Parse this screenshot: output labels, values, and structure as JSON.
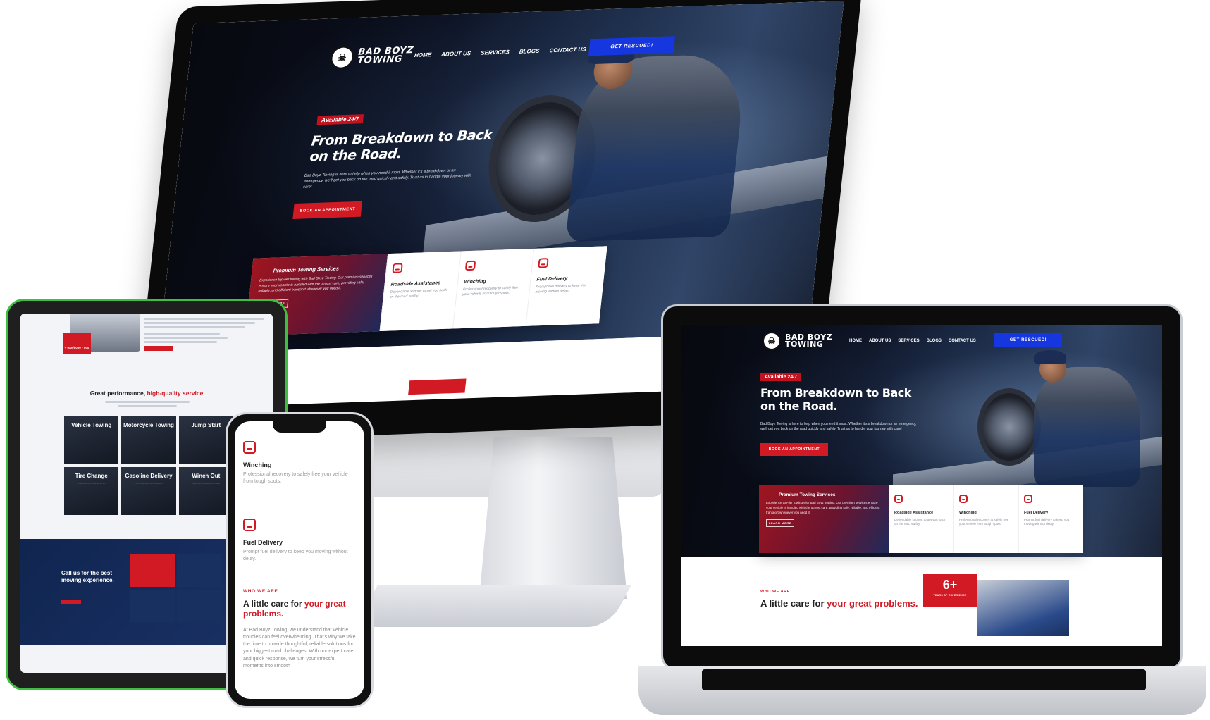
{
  "brand": {
    "name_line1": "BAD BOYZ",
    "name_line2": "TOWING"
  },
  "nav": [
    "HOME",
    "ABOUT US",
    "SERVICES",
    "BLOGS",
    "CONTACT US"
  ],
  "cta": "GET RESCUED!",
  "hero": {
    "badge": "Available 24/7",
    "title_line1": "From Breakdown to Back",
    "title_line2": "on the Road.",
    "subtitle": "Bad Boyz Towing is here to help when you need it most. Whether it's a breakdown or an emergency, we'll get you back on the road quickly and safely. Trust us to handle your journey with care!",
    "button": "BOOK AN APPOINTMENT"
  },
  "services": {
    "premium_title": "Premium Towing Services",
    "premium_text": "Experience top-tier towing with Bad Boyz Towing. Our premium services ensure your vehicle is handled with the utmost care, providing safe, reliable, and efficient transport whenever you need it.",
    "learn_more": "LEARN MORE",
    "cards": [
      {
        "title": "Roadside Assistance",
        "text": "Dependable support to get you back on the road swiftly."
      },
      {
        "title": "Winching",
        "text": "Professional recovery to safely free your vehicle from tough spots."
      },
      {
        "title": "Fuel Delivery",
        "text": "Prompt fuel delivery to keep you moving without delay."
      }
    ]
  },
  "about": {
    "eyebrow": "WHO WE ARE",
    "title_plain": "A little care for ",
    "title_accent": "your great problems.",
    "body": "At Bad Boyz Towing, we understand that vehicle troubles can feel overwhelming. That's why we take the time to provide thoughtful, reliable solutions for your biggest road challenges. With our expert care and quick response, we turn your stressful moments into smooth",
    "years_value": "6+",
    "years_label": "YEARS OF EXPERIENCE"
  },
  "tablet": {
    "performance_plain": "Great performance, ",
    "performance_accent": "high-quality service",
    "grid": [
      "Vehicle Towing",
      "Motorcycle Towing",
      "Jump Start",
      "Tire Change",
      "Gasoline Delivery",
      "Winch Out"
    ],
    "call_title": "Call us for the best moving experience.",
    "phone_label": "+ (000) 000 - 000"
  },
  "colors": {
    "accent_red": "#d11a24",
    "accent_blue": "#1636e0",
    "dark": "#0b1020"
  }
}
